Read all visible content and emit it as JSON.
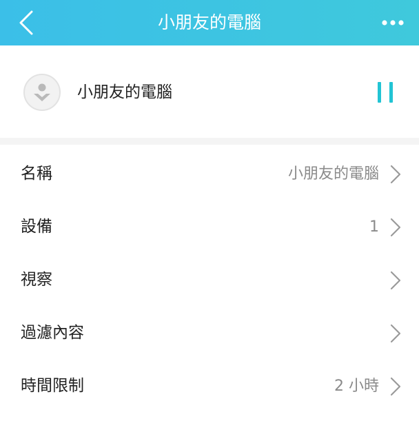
{
  "header": {
    "title": "小朋友的電腦",
    "back_icon": "chevron-left-icon",
    "more_icon": "more-horizontal-icon",
    "background": "#3bc3e4"
  },
  "profile": {
    "name": "小朋友的電腦",
    "avatar_icon": "user-avatar-icon",
    "pause_icon": "pause-icon",
    "accent": "#22c4d4"
  },
  "settings": [
    {
      "label": "名稱",
      "value": "小朋友的電腦"
    },
    {
      "label": "設備",
      "value": "1"
    },
    {
      "label": "視察",
      "value": ""
    },
    {
      "label": "過濾內容",
      "value": ""
    },
    {
      "label": "時間限制",
      "value": "2 小時"
    }
  ]
}
